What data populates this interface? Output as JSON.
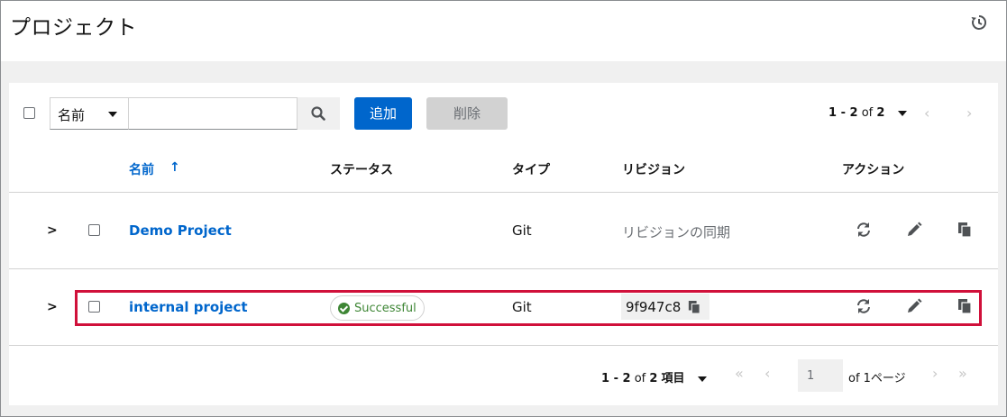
{
  "header": {
    "title": "プロジェクト",
    "history_icon": "history-icon"
  },
  "toolbar": {
    "filter_label": "名前",
    "search_placeholder": "",
    "add_label": "追加",
    "delete_label": "削除",
    "pagination": {
      "range": "1 - 2",
      "of": "of",
      "total": "2"
    }
  },
  "table": {
    "columns": {
      "name": "名前",
      "status": "ステータス",
      "type": "タイプ",
      "revision": "リビジョン",
      "actions": "アクション"
    },
    "rows": [
      {
        "name": "Demo Project",
        "status": "",
        "type": "Git",
        "revision": "リビジョンの同期"
      },
      {
        "name": "internal project",
        "status": "Successful",
        "type": "Git",
        "revision": "9f947c8"
      }
    ]
  },
  "footer": {
    "range": "1 - 2",
    "of": "of",
    "total": "2",
    "items_label": "項目",
    "page_value": "1",
    "of_pages": "of 1ページ"
  },
  "colors": {
    "primary": "#0066cc",
    "success": "#3e8635",
    "highlight": "#d0103a"
  }
}
